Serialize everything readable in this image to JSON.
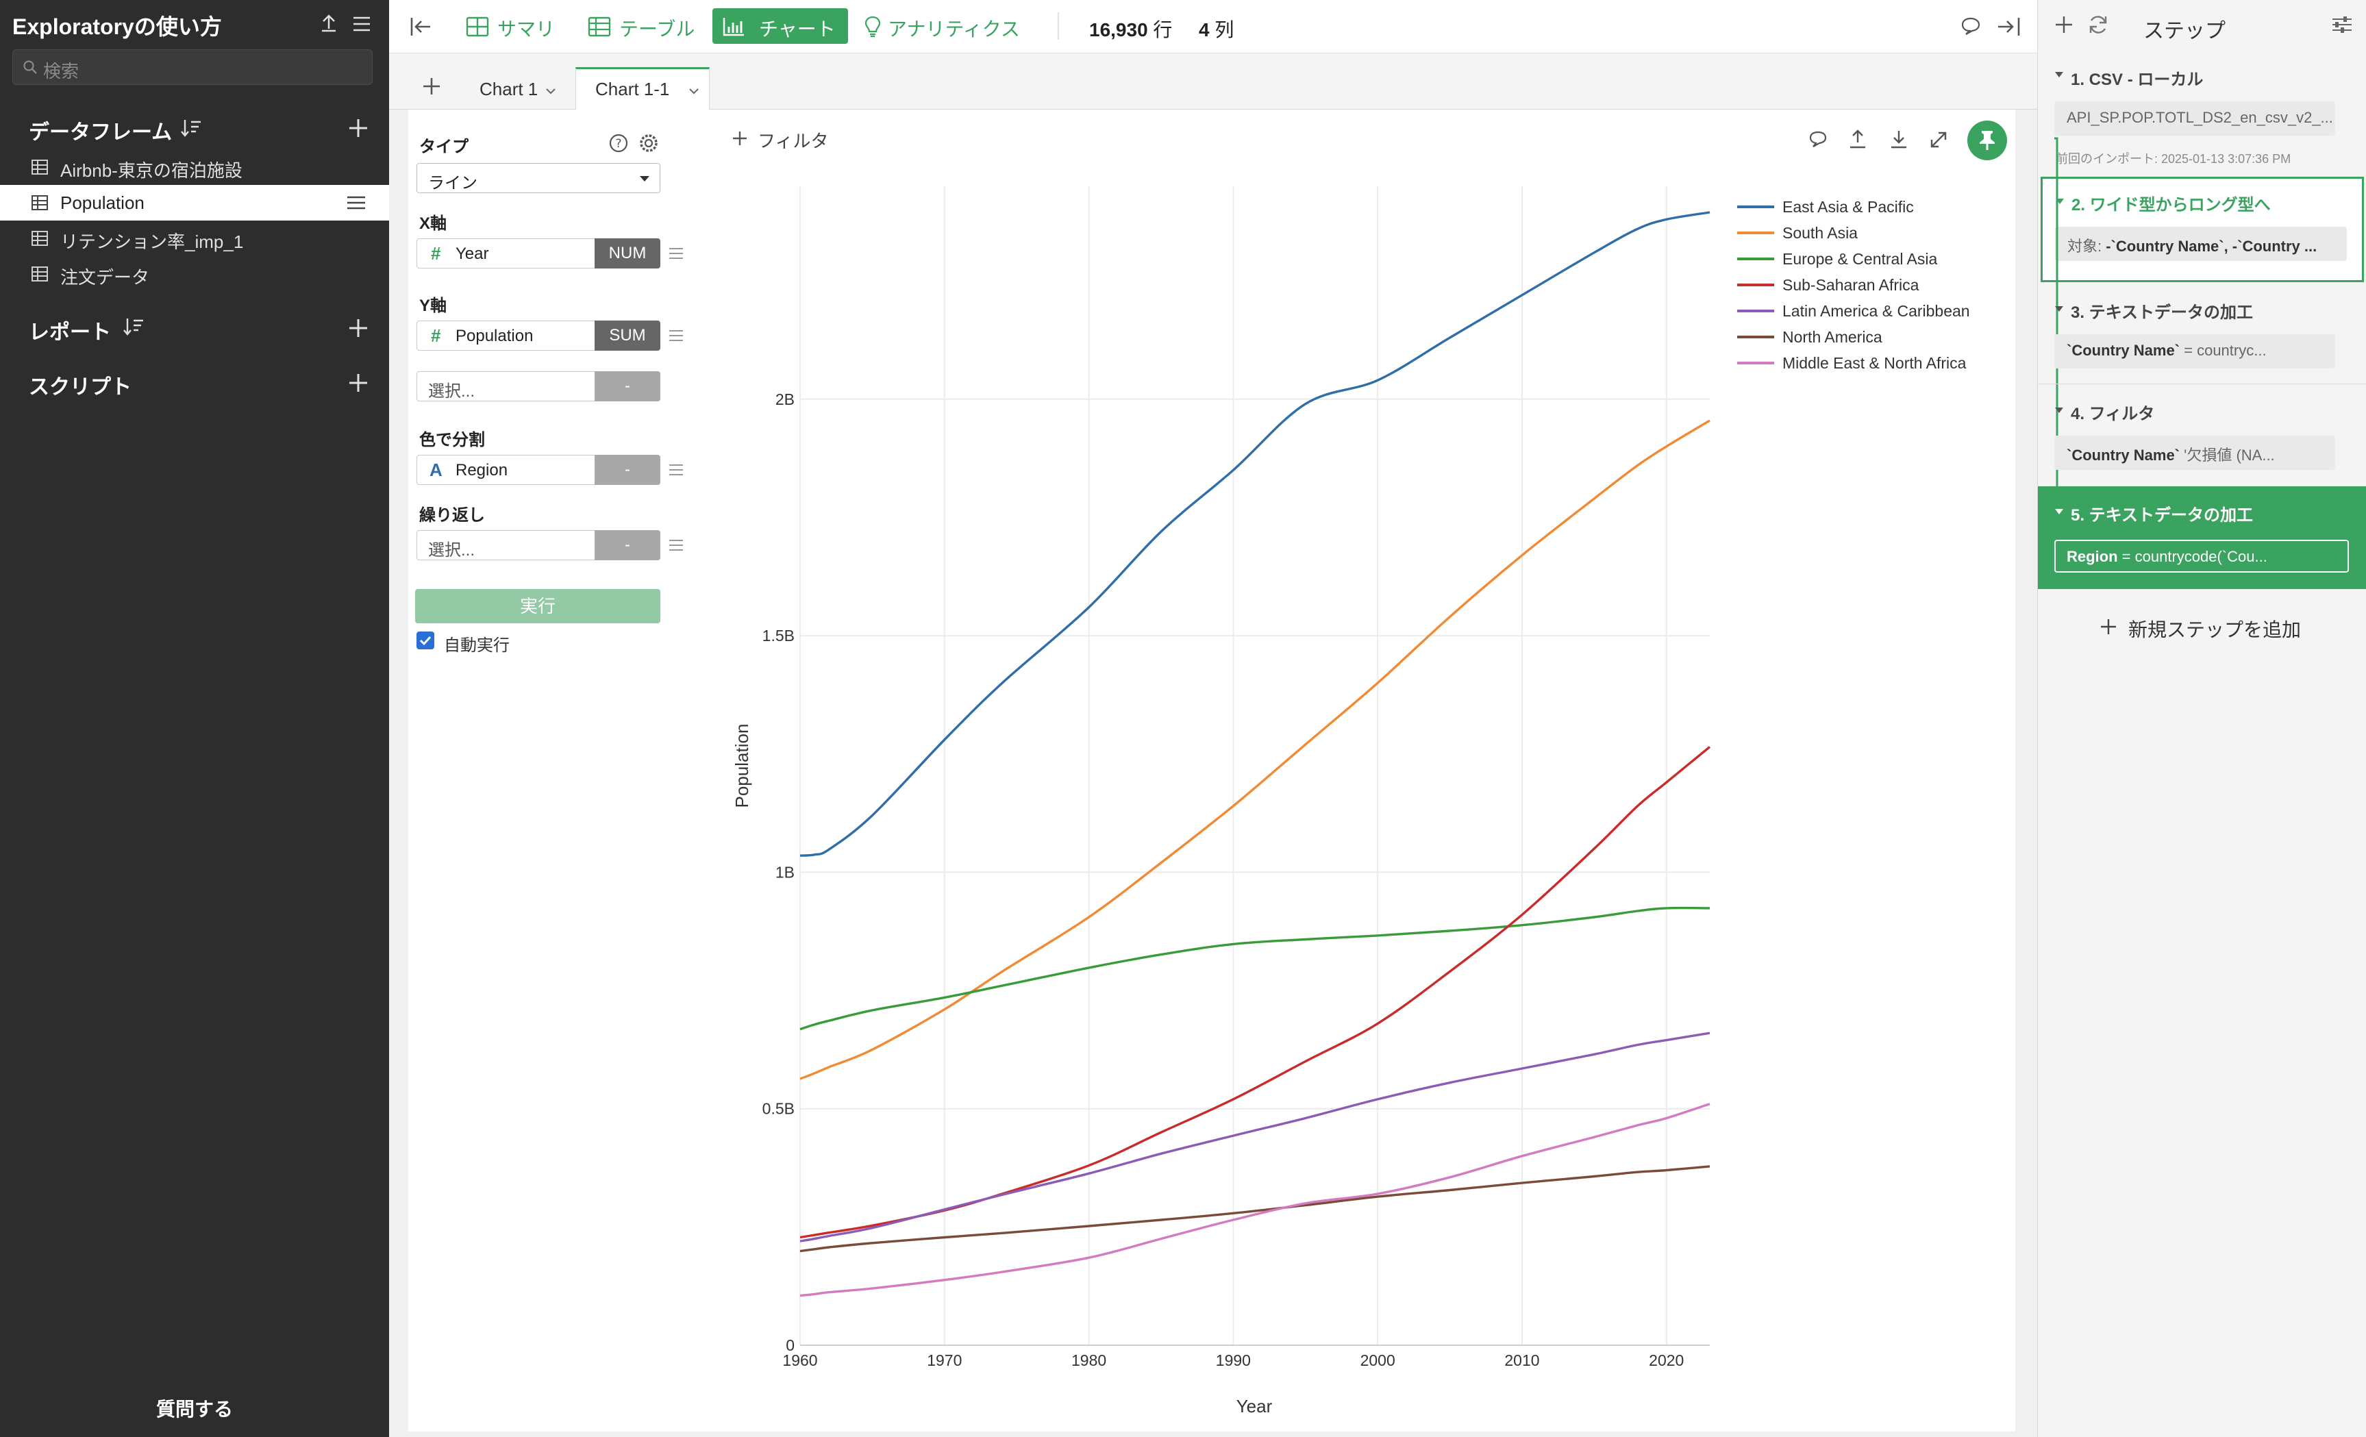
{
  "sidebar": {
    "title": "Exploratoryの使い方",
    "search_placeholder": "検索",
    "dataframes_label": "データフレーム",
    "dataframes": [
      "Airbnb-東京の宿泊施設",
      "Population",
      "リテンション率_imp_1",
      "注文データ"
    ],
    "selected_dataframe": "Population",
    "reports_label": "レポート",
    "scripts_label": "スクリプト",
    "ask_label": "質問する"
  },
  "topbar": {
    "summary": "サマリ",
    "table": "テーブル",
    "chart": "チャート",
    "analytics": "アナリティクス",
    "rows_value": "16,930",
    "rows_unit": "行",
    "cols_value": "4",
    "cols_unit": "列",
    "active_tab": "チャート"
  },
  "tabs": [
    "Chart 1",
    "Chart 1-1"
  ],
  "active_tab": "Chart 1-1",
  "chart_config": {
    "type_label": "タイプ",
    "type_value": "ライン",
    "x_label": "X軸",
    "x_field": "Year",
    "x_agg": "NUM",
    "y_label": "Y軸",
    "y_field": "Population",
    "y_agg": "SUM",
    "y2_placeholder": "選択...",
    "y2_agg": "-",
    "color_label": "色で分割",
    "color_field": "Region",
    "color_agg": "-",
    "repeat_label": "繰り返し",
    "repeat_placeholder": "選択...",
    "repeat_agg": "-",
    "run_label": "実行",
    "auto_run_label": "自動実行",
    "auto_run_checked": true
  },
  "filter_label": "フィルタ",
  "steps": {
    "title": "ステップ",
    "items": [
      {
        "label": "1. CSV - ローカル",
        "detail": "API_SP.POP.TOTL_DS2_en_csv_v2_...",
        "note": "前回のインポート: 2025-01-13 3:07:36 PM"
      },
      {
        "label": "2. ワイド型からロング型へ",
        "detail_prefix": "対象: ",
        "detail": "-`Country Name`, -`Country ..."
      },
      {
        "label": "3. テキストデータの加工",
        "detail": "`Country Name`",
        "detail_suffix": " = countryc..."
      },
      {
        "label": "4. フィルタ",
        "detail": "`Country Name`",
        "detail_suffix": " '欠損値 (NA..."
      },
      {
        "label": "5. テキストデータの加工",
        "detail": "Region",
        "detail_suffix": " = countrycode(`Cou..."
      }
    ],
    "add_label": "新規ステップを追加"
  },
  "colors": {
    "accent": "#3aa360",
    "sidebar_bg": "#2c2d2c"
  },
  "chart_data": {
    "type": "line",
    "title": "",
    "xlabel": "Year",
    "ylabel": "Population",
    "xlim": [
      1960,
      2023
    ],
    "ylim": [
      0,
      2450000000
    ],
    "x_ticks": [
      1960,
      1970,
      1980,
      1990,
      2000,
      2010,
      2020
    ],
    "y_ticks": [
      {
        "value": 0,
        "label": "0"
      },
      {
        "value": 500000000,
        "label": "0.5B"
      },
      {
        "value": 1000000000,
        "label": "1B"
      },
      {
        "value": 1500000000,
        "label": "1.5B"
      },
      {
        "value": 2000000000,
        "label": "2B"
      }
    ],
    "grid": true,
    "legend_position": "top-right",
    "x": [
      1960,
      1961,
      1962,
      1965,
      1970,
      1974,
      1980,
      1985,
      1990,
      1995,
      2000,
      2005,
      2010,
      2015,
      2018,
      2020,
      2023
    ],
    "series": [
      {
        "name": "East Asia & Pacific",
        "color": "#2f6ea8",
        "values": [
          1035000000,
          1037000000,
          1048000000,
          1120000000,
          1280000000,
          1400000000,
          1560000000,
          1720000000,
          1850000000,
          1990000000,
          2040000000,
          2130000000,
          2220000000,
          2310000000,
          2360000000,
          2380000000,
          2395000000
        ]
      },
      {
        "name": "South Asia",
        "color": "#f08a33",
        "values": [
          563000000,
          575000000,
          588000000,
          625000000,
          710000000,
          790000000,
          905000000,
          1020000000,
          1140000000,
          1270000000,
          1400000000,
          1540000000,
          1670000000,
          1790000000,
          1860000000,
          1900000000,
          1955000000
        ]
      },
      {
        "name": "Europe & Central Asia",
        "color": "#3a9b3a",
        "values": [
          668000000,
          678000000,
          686000000,
          708000000,
          735000000,
          760000000,
          798000000,
          826000000,
          848000000,
          858000000,
          866000000,
          876000000,
          888000000,
          905000000,
          918000000,
          924000000,
          924000000
        ]
      },
      {
        "name": "Sub-Saharan Africa",
        "color": "#c92a2a",
        "values": [
          228000000,
          233000000,
          238000000,
          253000000,
          285000000,
          320000000,
          380000000,
          450000000,
          520000000,
          600000000,
          680000000,
          790000000,
          910000000,
          1050000000,
          1140000000,
          1190000000,
          1265000000
        ]
      },
      {
        "name": "Latin America & Caribbean",
        "color": "#8a5cb8",
        "values": [
          220000000,
          225000000,
          231000000,
          248000000,
          287000000,
          318000000,
          363000000,
          405000000,
          443000000,
          480000000,
          520000000,
          555000000,
          585000000,
          615000000,
          635000000,
          645000000,
          660000000
        ]
      },
      {
        "name": "North America",
        "color": "#7a4a3a",
        "values": [
          199000000,
          203000000,
          207000000,
          216000000,
          228000000,
          237000000,
          252000000,
          265000000,
          279000000,
          296000000,
          314000000,
          328000000,
          343000000,
          357000000,
          366000000,
          370000000,
          378000000
        ]
      },
      {
        "name": "Middle East & North Africa",
        "color": "#d47ac0",
        "values": [
          105000000,
          108000000,
          112000000,
          120000000,
          138000000,
          155000000,
          185000000,
          225000000,
          265000000,
          300000000,
          320000000,
          355000000,
          400000000,
          440000000,
          465000000,
          480000000,
          510000000
        ]
      }
    ]
  }
}
